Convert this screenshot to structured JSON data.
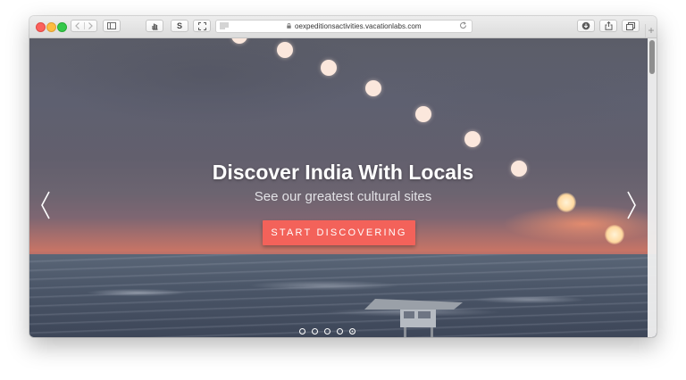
{
  "browser": {
    "url": "oexpeditionsactivities.vacationlabs.com",
    "toolbar_icons": [
      "back-icon",
      "forward-icon",
      "sidebar-icon",
      "hand-icon",
      "s-icon",
      "fullscreen-icon",
      "reader-icon",
      "lock-icon",
      "reload-icon",
      "download-icon",
      "share-icon",
      "tabs-icon",
      "new-tab-icon"
    ],
    "s_label": "S",
    "plus_label": "+"
  },
  "hero": {
    "title": "Discover India With Locals",
    "subtitle": "See our greatest cultural sites",
    "cta_label": "START DISCOVERING",
    "cta_color": "#f3625a"
  },
  "carousel": {
    "slide_count": 5,
    "active_index": 4
  }
}
